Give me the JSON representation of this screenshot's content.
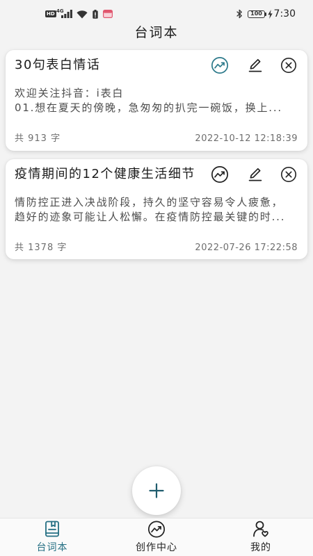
{
  "status_bar": {
    "hd_badge": "HD",
    "network_type": "4G",
    "battery_level": "100",
    "time": "7:30",
    "left_icons": [
      "signal-icon",
      "wifi-icon",
      "battery-alert-icon",
      "notification-icon"
    ],
    "right_icons": [
      "bluetooth-icon",
      "battery-icon",
      "charging-icon"
    ]
  },
  "header": {
    "title": "台词本"
  },
  "cards": [
    {
      "title": "30句表白情话",
      "body_lines": [
        "欢迎关注抖音：i表白",
        "01.想在夏天的傍晚，急匆匆的扒完一碗饭，换上..."
      ],
      "word_count": "共 913 字",
      "date": "2022-10-12 12:18:39",
      "actions": [
        {
          "icon": "trend-icon",
          "color": "#2d7a8b"
        },
        {
          "icon": "pencil-icon",
          "color": "#222222"
        },
        {
          "icon": "close-circle-icon",
          "color": "#222222"
        }
      ]
    },
    {
      "title": "疫情期间的12个健康生活细节",
      "body_lines": [
        "情防控正进入决战阶段，持久的坚守容易令人疲惫，",
        "趋好的迹象可能让人松懈。在疫情防控最关键的时..."
      ],
      "word_count": "共 1378 字",
      "date": "2022-07-26 17:22:58",
      "actions": [
        {
          "icon": "trend-icon",
          "color": "#222222"
        },
        {
          "icon": "pencil-icon",
          "color": "#222222"
        },
        {
          "icon": "close-circle-icon",
          "color": "#222222"
        }
      ]
    }
  ],
  "fab": {
    "icon": "plus-icon"
  },
  "nav": {
    "items": [
      {
        "label": "台词本",
        "icon": "script-book-icon",
        "active": true
      },
      {
        "label": "创作中心",
        "icon": "creation-trend-icon",
        "active": false
      },
      {
        "label": "我的",
        "icon": "profile-heart-icon",
        "active": false
      }
    ]
  },
  "colors": {
    "accent": "#246f83",
    "background": "#f3f3f3",
    "card": "#ffffff",
    "fab_icon": "#1f5c6d"
  }
}
